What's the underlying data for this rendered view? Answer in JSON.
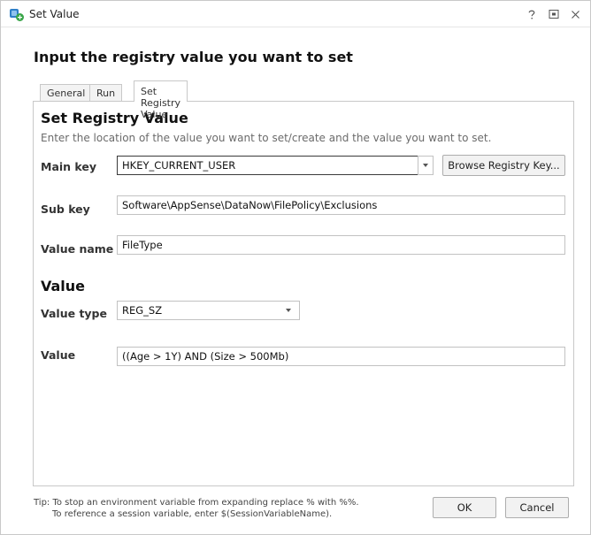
{
  "window": {
    "title": "Set Value",
    "controls": [
      "help-icon",
      "restore-icon",
      "close-icon"
    ]
  },
  "heading": "Input the registry value you want to set",
  "tabs": [
    {
      "label": "General",
      "active": false
    },
    {
      "label": "Run As",
      "active": false
    },
    {
      "label": "Set Registry Value",
      "active": true
    }
  ],
  "registry": {
    "section_title": "Set Registry Value",
    "description": "Enter the location of the value you want to set/create and the value you want to set.",
    "main_key_label": "Main key",
    "main_key_value": "HKEY_CURRENT_USER",
    "browse_label": "Browse Registry Key...",
    "sub_key_label": "Sub key",
    "sub_key_value": "Software\\AppSense\\DataNow\\FilePolicy\\Exclusions",
    "value_name_label": "Value name",
    "value_name_value": "FileType"
  },
  "value": {
    "section_title": "Value",
    "type_label": "Value type",
    "type_value": "REG_SZ",
    "value_label": "Value",
    "value_value": "((Age > 1Y) AND (Size > 500Mb)"
  },
  "tip": {
    "line1": "Tip: To stop an environment variable from expanding replace % with %%.",
    "line2": "To reference a session variable, enter $(SessionVariableName)."
  },
  "buttons": {
    "ok": "OK",
    "cancel": "Cancel"
  },
  "colors": {
    "icon_green": "#3aa64a",
    "icon_blue": "#2f80c8",
    "border": "#c8c8c8",
    "focus_border": "#3a3a3a"
  }
}
